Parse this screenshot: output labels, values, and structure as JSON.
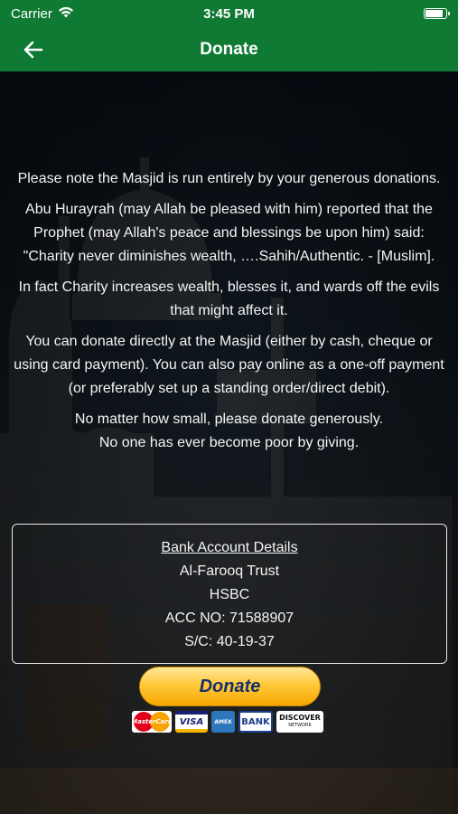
{
  "status_bar": {
    "carrier": "Carrier",
    "time": "3:45 PM"
  },
  "nav": {
    "title": "Donate",
    "back_icon": "arrow-left-icon"
  },
  "content": {
    "paragraphs": [
      "Please note the Masjid is run entirely by your generous donations.",
      "Abu Hurayrah (may Allah be pleased with him) reported that the Prophet (may Allah's peace and blessings be upon him) said: \"Charity never diminishes wealth, ….Sahih/Authentic. - [Muslim].",
      "In fact Charity increases wealth, blesses it, and wards off the evils that might affect it.",
      "You can donate directly at the Masjid (either by cash, cheque or using card payment). You can also pay online as a one-off payment (or preferably set up a standing order/direct debit).",
      "No matter how small, please donate generously.",
      "No one has ever become poor by giving."
    ]
  },
  "bank": {
    "heading": "Bank Account Details",
    "name": "Al-Farooq Trust",
    "bank_name": "HSBC",
    "account": "ACC NO: 71588907",
    "sort_code": "S/C: 40-19-37"
  },
  "paypal": {
    "button_label": "Donate",
    "cards": [
      "MasterCard",
      "VISA",
      "AMEX",
      "BANK",
      "DISCOVER"
    ],
    "discover_sub": "NETWORK"
  },
  "colors": {
    "header_green": "#0f7a34",
    "paypal_gold": "#ffc93a"
  }
}
